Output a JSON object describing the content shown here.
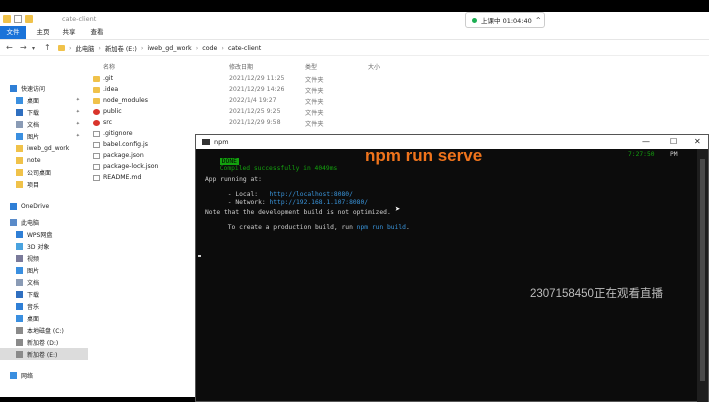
{
  "explorer": {
    "title": "cate-client",
    "ribbon_tabs": [
      "文件",
      "主页",
      "共享",
      "查看"
    ],
    "breadcrumb": [
      "此电脑",
      "新加卷 (E:)",
      "iweb_gd_work",
      "code",
      "cate-client"
    ],
    "columns": {
      "name": "名称",
      "date": "修改日期",
      "type": "类型",
      "size": "大小"
    },
    "sidebar": [
      {
        "label": "快速访问",
        "icon": "star-icon",
        "pin": false
      },
      {
        "label": "桌面",
        "icon": "desktop-icon",
        "pin": true
      },
      {
        "label": "下载",
        "icon": "download-icon",
        "pin": true
      },
      {
        "label": "文档",
        "icon": "document-icon",
        "pin": true
      },
      {
        "label": "图片",
        "icon": "picture-icon",
        "pin": true
      },
      {
        "label": "iweb_gd_work",
        "icon": "folder-icon",
        "pin": false
      },
      {
        "label": "note",
        "icon": "folder-icon",
        "pin": false
      },
      {
        "label": "公司桌面",
        "icon": "folder-icon",
        "pin": false
      },
      {
        "label": "项目",
        "icon": "folder-icon",
        "pin": false
      },
      {
        "label": "OneDrive",
        "icon": "cloud-icon",
        "pin": false
      },
      {
        "label": "此电脑",
        "icon": "computer-icon",
        "pin": false
      },
      {
        "label": "WPS网盘",
        "icon": "cloud-icon",
        "pin": false
      },
      {
        "label": "3D 对象",
        "icon": "cube-icon",
        "pin": false
      },
      {
        "label": "视频",
        "icon": "video-icon",
        "pin": false
      },
      {
        "label": "图片",
        "icon": "picture-icon",
        "pin": false
      },
      {
        "label": "文档",
        "icon": "document-icon",
        "pin": false
      },
      {
        "label": "下载",
        "icon": "download-icon",
        "pin": false
      },
      {
        "label": "音乐",
        "icon": "music-icon",
        "pin": false
      },
      {
        "label": "桌面",
        "icon": "desktop-icon",
        "pin": false
      },
      {
        "label": "本地磁盘 (C:)",
        "icon": "drive-icon",
        "pin": false
      },
      {
        "label": "新加卷 (D:)",
        "icon": "drive-icon",
        "pin": false
      },
      {
        "label": "新加卷 (E:)",
        "icon": "drive-icon",
        "pin": false,
        "selected": true
      },
      {
        "label": "网络",
        "icon": "network-icon",
        "pin": false
      }
    ],
    "files": [
      {
        "name": ".git",
        "date": "2021/12/29 11:25",
        "type": "文件夹",
        "icon": "folder-icon"
      },
      {
        "name": ".idea",
        "date": "2021/12/29 14:26",
        "type": "文件夹",
        "icon": "folder-icon"
      },
      {
        "name": "node_modules",
        "date": "2022/1/4 19:27",
        "type": "文件夹",
        "icon": "folder-icon"
      },
      {
        "name": "public",
        "date": "2021/12/25 9:25",
        "type": "文件夹",
        "icon": "folder-icon"
      },
      {
        "name": "src",
        "date": "2021/12/29 9:58",
        "type": "文件夹",
        "icon": "folder-icon"
      },
      {
        "name": ".gitignore",
        "date": "",
        "type": "",
        "icon": "file-icon"
      },
      {
        "name": "babel.config.js",
        "date": "",
        "type": "",
        "icon": "file-icon"
      },
      {
        "name": "package.json",
        "date": "",
        "type": "",
        "icon": "file-icon"
      },
      {
        "name": "package-lock.json",
        "date": "",
        "type": "",
        "icon": "file-icon"
      },
      {
        "name": "README.md",
        "date": "",
        "type": "",
        "icon": "file-icon"
      }
    ]
  },
  "recording": {
    "label": "上课中 01:04:40"
  },
  "terminal": {
    "title": "npm",
    "done_badge": "DONE",
    "compiled": "Compiled successfully in 4049ms",
    "time": "7:27:50",
    "right_fragment": "PM",
    "running": "App running at:",
    "local_label": "- Local:   ",
    "local_url": "http://localhost:8080/",
    "network_label": "- Network: ",
    "network_url": "http://192.168.1.107:8080/",
    "note1": "Note that the development build is not optimized.",
    "note2_pre": "To create a production build, run ",
    "note2_cmd": "npm run build",
    "note2_post": "."
  },
  "overlay": {
    "command": "npm run serve",
    "watching": "2307158450正在观看直播"
  }
}
